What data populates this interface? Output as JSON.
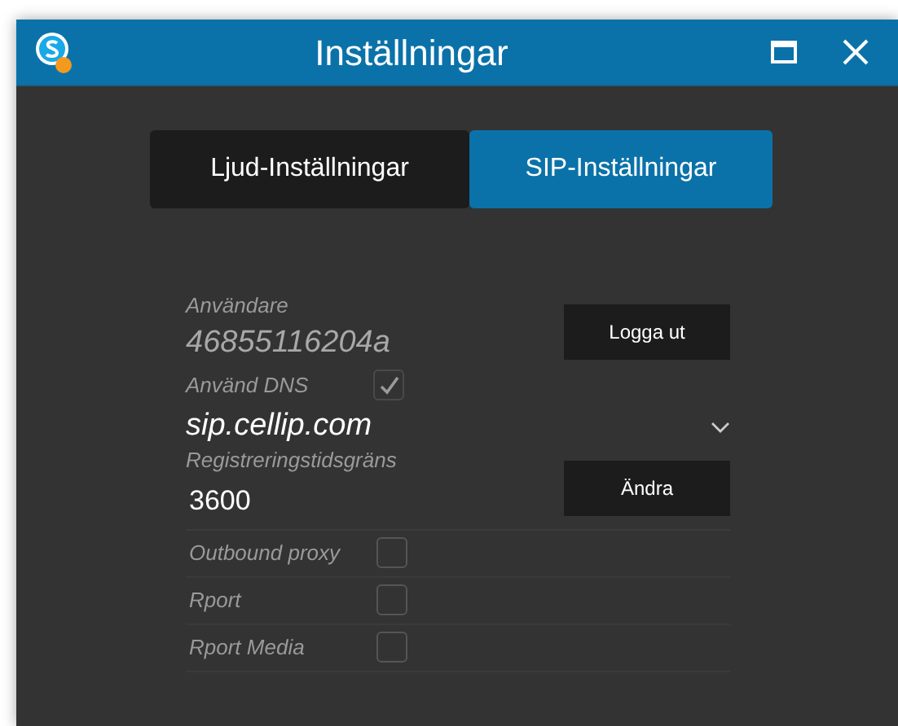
{
  "window": {
    "title": "Inställningar"
  },
  "tabs": [
    {
      "label": "Ljud-Inställningar",
      "selected": false
    },
    {
      "label": "SIP-Inställningar",
      "selected": true
    }
  ],
  "user": {
    "label": "Användare",
    "value": "46855116204a"
  },
  "logout_button": "Logga ut",
  "use_dns": {
    "label": "Använd DNS",
    "checked": true,
    "disabled": true
  },
  "server": {
    "value": "sip.cellip.com"
  },
  "registration": {
    "label": "Registreringstidsgräns",
    "value": "3600"
  },
  "change_button": "Ändra",
  "options": [
    {
      "label": "Outbound proxy",
      "checked": false
    },
    {
      "label": "Rport",
      "checked": false
    },
    {
      "label": "Rport Media",
      "checked": false
    }
  ]
}
